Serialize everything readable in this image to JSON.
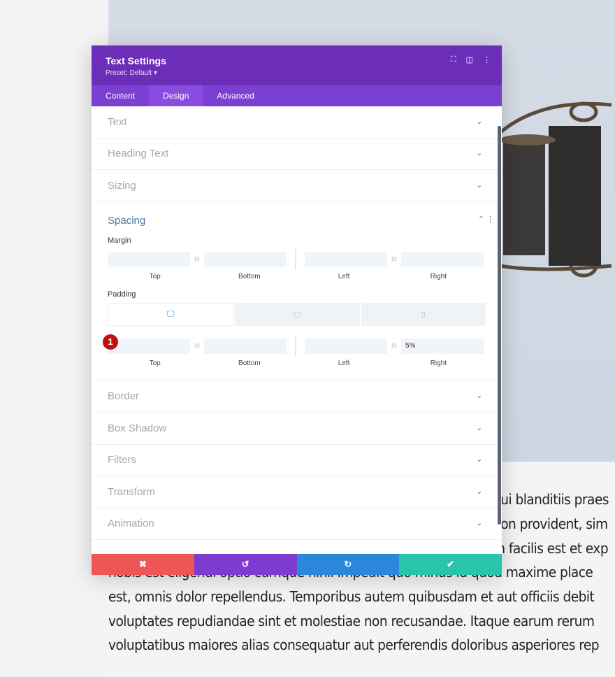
{
  "panel": {
    "title": "Text Settings",
    "preset": "Preset: Default ▾",
    "tabs": [
      {
        "label": "Content"
      },
      {
        "label": "Design"
      },
      {
        "label": "Advanced"
      }
    ],
    "sections_top": [
      "Text",
      "Heading Text",
      "Sizing"
    ],
    "spacing": {
      "title": "Spacing",
      "margin_label": "Margin",
      "padding_label": "Padding",
      "captions": [
        "Top",
        "Bottom",
        "Left",
        "Right"
      ],
      "padding_right_value": "5%",
      "badge": "1"
    },
    "sections_bottom": [
      "Border",
      "Box Shadow",
      "Filters",
      "Transform",
      "Animation"
    ]
  },
  "footer": {
    "colors": {
      "cancel": "#ef5555",
      "undo": "#7e3bd0",
      "redo": "#2b87da",
      "save": "#29c4a9"
    }
  },
  "body_text": [
    "qui blanditiis praes",
    "non provident, sim",
    "m facilis est et exp",
    "nobis est eligendi optio cumque nihil impedit quo minus id quod maxime place",
    "est, omnis dolor repellendus. Temporibus autem quibusdam et aut officiis debit",
    "voluptates repudiandae sint et molestiae non recusandae. Itaque earum rerum",
    "voluptatibus maiores alias consequatur aut perferendis doloribus asperiores rep"
  ]
}
